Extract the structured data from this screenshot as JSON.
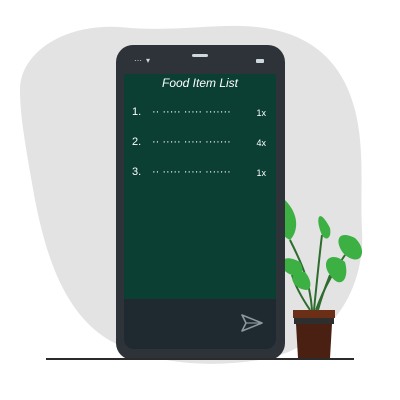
{
  "app": {
    "title": "Food Item List"
  },
  "list": {
    "items": [
      {
        "number": "1.",
        "name": "·· ····· ····· ·······",
        "qty": "1x"
      },
      {
        "number": "2.",
        "name": "·· ····· ····· ·······",
        "qty": "4x"
      },
      {
        "number": "3.",
        "name": "·· ····· ····· ·······",
        "qty": "1x"
      }
    ]
  },
  "compose": {
    "send_icon": "send-icon"
  },
  "colors": {
    "screen": "#0b3f34",
    "phone": "#2e3339",
    "background_blob": "#e3e3e3",
    "leaf": "#3cb043",
    "pot": "#4a2012"
  }
}
